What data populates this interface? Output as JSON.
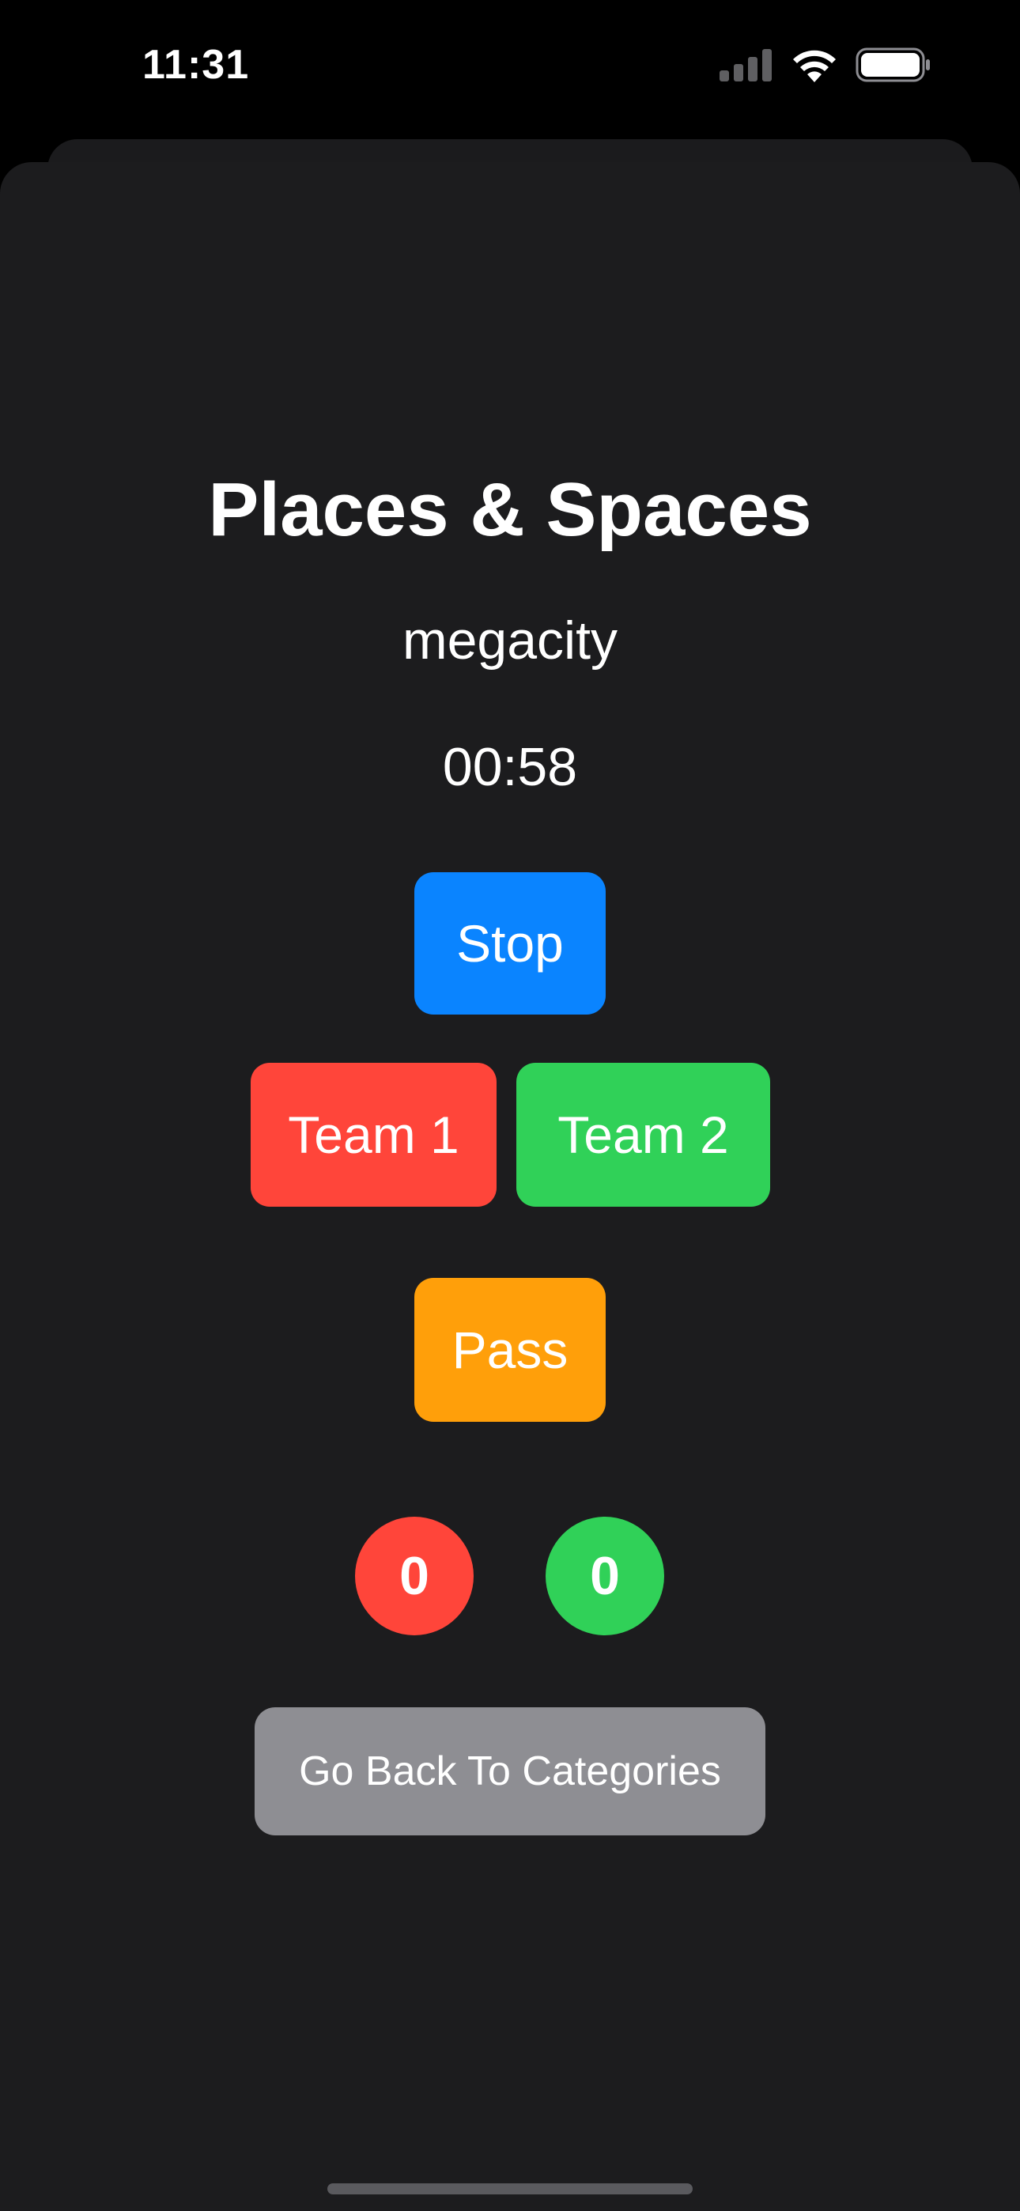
{
  "status_bar": {
    "time": "11:31",
    "icons": [
      "cellular-signal-icon",
      "wifi-icon",
      "battery-icon"
    ]
  },
  "game": {
    "category_title": "Places & Spaces",
    "current_word": "megacity",
    "timer": "00:58"
  },
  "buttons": {
    "stop_label": "Stop",
    "team1_label": "Team 1",
    "team2_label": "Team 2",
    "pass_label": "Pass",
    "back_label": "Go Back To Categories"
  },
  "scores": {
    "team1": "0",
    "team2": "0"
  },
  "colors": {
    "background": "#1c1c1e",
    "stop": "#0a84ff",
    "team1": "#ff453a",
    "team2": "#30d158",
    "pass": "#ff9f0a",
    "back": "#8e8e93"
  }
}
